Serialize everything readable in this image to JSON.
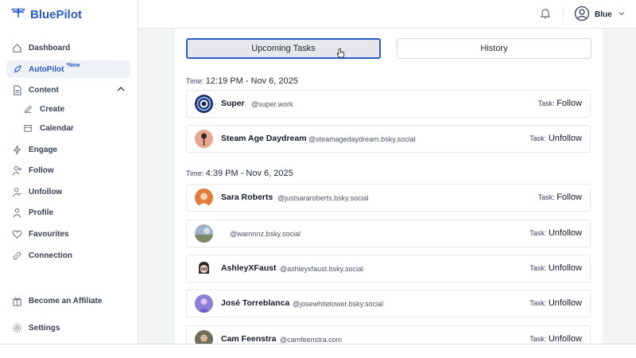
{
  "brand": {
    "name": "BluePilot",
    "accent": "#2b5cc7"
  },
  "sidebar": {
    "items": [
      {
        "label": "Dashboard",
        "icon": "home-icon"
      },
      {
        "label": "AutoPilot",
        "badge": "*New",
        "icon": "rocket-icon",
        "active": true
      },
      {
        "label": "Content",
        "icon": "document-icon",
        "expanded": true
      },
      {
        "label": "Create",
        "icon": "edit-icon"
      },
      {
        "label": "Calendar",
        "icon": "calendar-icon"
      },
      {
        "label": "Engage",
        "icon": "lightning-icon"
      },
      {
        "label": "Follow",
        "icon": "user-plus-icon"
      },
      {
        "label": "Unfollow",
        "icon": "user-minus-icon"
      },
      {
        "label": "Profile",
        "icon": "user-icon"
      },
      {
        "label": "Favourites",
        "icon": "heart-icon"
      },
      {
        "label": "Connection",
        "icon": "link-icon"
      },
      {
        "label": "Become an Affiliate",
        "icon": "gift-icon"
      },
      {
        "label": "Settings",
        "icon": "gear-icon"
      }
    ]
  },
  "topbar": {
    "user_name": "Blue"
  },
  "tabs": [
    {
      "label": "Upcoming Tasks",
      "active": true
    },
    {
      "label": "History",
      "active": false
    }
  ],
  "groups": [
    {
      "time_prefix": "Time:",
      "time_value": "12:19 PM - Nov 6, 2025",
      "rows": [
        {
          "name": "Super",
          "handle": "@super.work",
          "task_prefix": "Task:",
          "task": "Follow"
        },
        {
          "name": "Steam Age Daydream",
          "handle": "@steamagedaydream.bsky.social",
          "task_prefix": "Task:",
          "task": "Unfollow"
        }
      ]
    },
    {
      "time_prefix": "Time:",
      "time_value": "4:39 PM - Nov 6, 2025",
      "rows": [
        {
          "name": "Sara Roberts",
          "handle": "@justsararoberts.bsky.social",
          "task_prefix": "Task:",
          "task": "Follow"
        },
        {
          "name": "",
          "handle": "@warnnnz.bsky.social",
          "task_prefix": "Task:",
          "task": "Unfollow"
        },
        {
          "name": "AshleyXFaust",
          "handle": "@ashleyxfaust.bsky.social",
          "task_prefix": "Task:",
          "task": "Unfollow"
        },
        {
          "name": "José Torreblanca",
          "handle": "@josewhitetower.bsky.social",
          "task_prefix": "Task:",
          "task": "Unfollow"
        },
        {
          "name": "Cam Feenstra",
          "handle": "@camfeenstra.com",
          "task_prefix": "Task:",
          "task": "Unfollow"
        }
      ]
    }
  ]
}
